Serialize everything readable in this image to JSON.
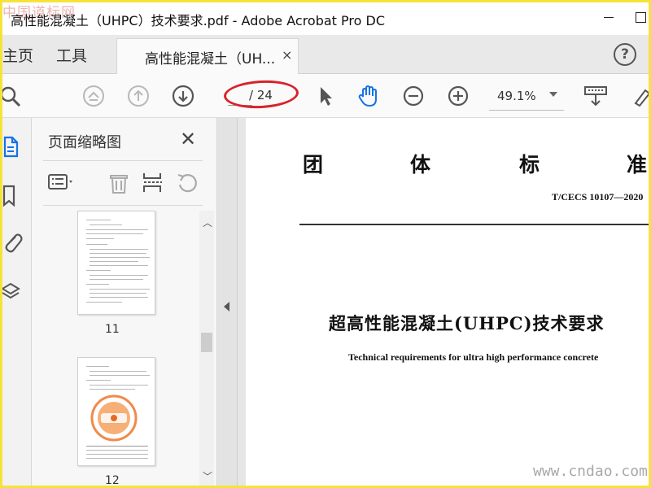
{
  "window": {
    "title": "高性能混凝土（UHPC）技术要求.pdf - Adobe Acrobat Pro DC",
    "watermark_tl": "中国道标网",
    "watermark_br": "www.cndao.com"
  },
  "tabs": {
    "home": "主页",
    "tools": "工具",
    "document": "高性能混凝土（UH...",
    "close": "×"
  },
  "toolbar": {
    "page_current": "",
    "page_total": "/ 24",
    "zoom": "49.1%"
  },
  "panel": {
    "title": "页面缩略图",
    "close": "✕",
    "pages": [
      {
        "label": "11"
      },
      {
        "label": "12"
      }
    ]
  },
  "document": {
    "header_chars": [
      "团",
      "体",
      "标",
      "准"
    ],
    "code": "T/CECS  10107—2020",
    "title_zh": "超高性能混凝土(UHPC)技术要求",
    "title_en": "Technical requirements for ultra high performance concrete"
  },
  "colors": {
    "accent_blue": "#1473e6",
    "annotation_red": "#d8232a",
    "border_yellow": "#f5e33a"
  }
}
